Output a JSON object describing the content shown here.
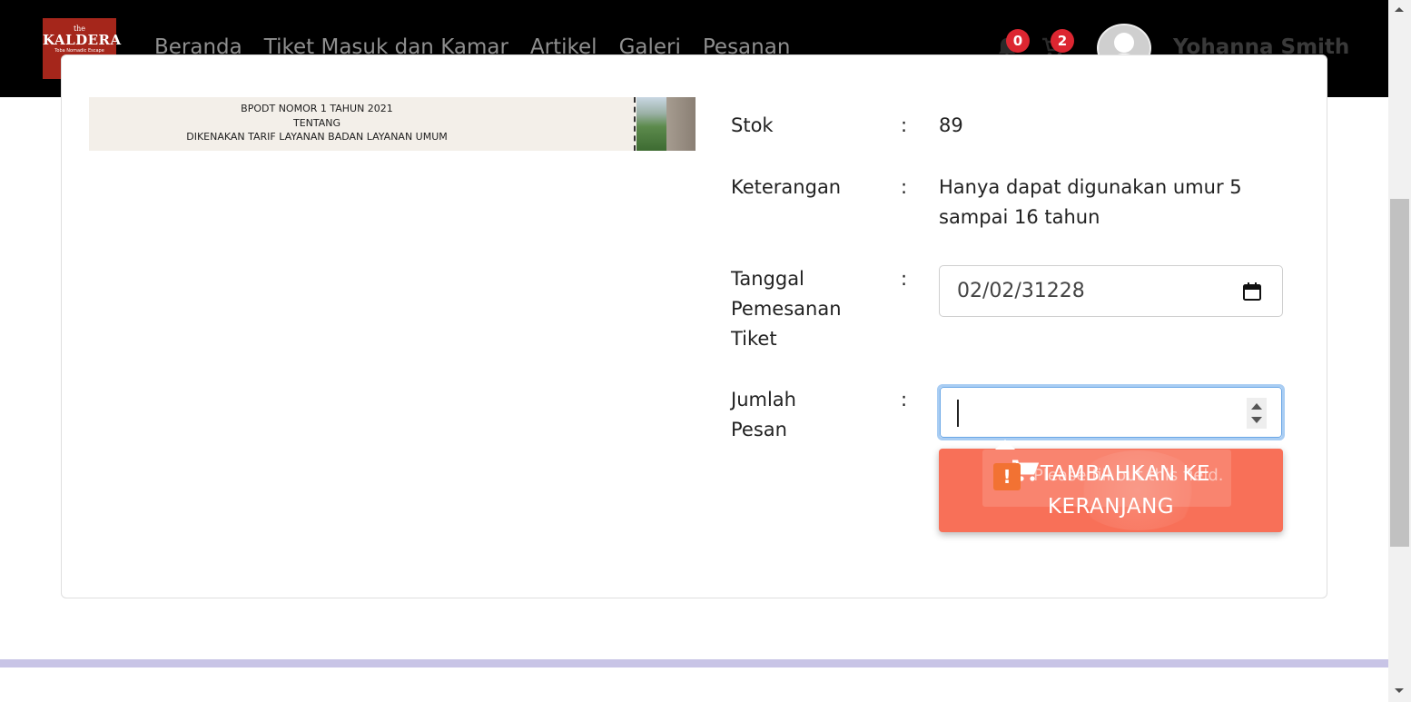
{
  "header": {
    "logo": {
      "small": "the",
      "name": "KALDERA",
      "tagline": "Toba Nomadic Escape"
    },
    "nav_items": [
      "Beranda",
      "Tiket Masuk dan Kamar",
      "Artikel",
      "Galeri",
      "Pesanan"
    ],
    "notifications_count": "0",
    "cart_count": "2",
    "user_name": "Yohanna Smith"
  },
  "poster": {
    "lines": [
      "BPODT NOMOR 1 TAHUN 2021",
      "TENTANG",
      "DIKENAKAN TARIF LAYANAN BADAN LAYANAN UMUM"
    ]
  },
  "details": {
    "stok_label": "Stok",
    "stok_value": "89",
    "keterangan_label": "Keterangan",
    "keterangan_line1": "Hanya dapat digunakan umur 5",
    "keterangan_line2": "sampai 16 tahun",
    "tanggal_label_1": "Tanggal",
    "tanggal_label_2": "Pemesanan",
    "tanggal_label_3": "Tiket",
    "tanggal_value": "02/02/31228",
    "jumlah_label_1": "Jumlah",
    "jumlah_label_2": "Pesan",
    "jumlah_value": "",
    "colon": ":"
  },
  "button": {
    "line1": "TAMBAHKAN KE",
    "line2": "KERANJANG"
  },
  "validation": {
    "message": "Please fill out this field."
  },
  "colors": {
    "navbar": "#000000",
    "accent_button": "#f87058",
    "badge": "#dc2631",
    "logo_bg": "#a5261b",
    "footer_bar": "#c8c4e6"
  }
}
